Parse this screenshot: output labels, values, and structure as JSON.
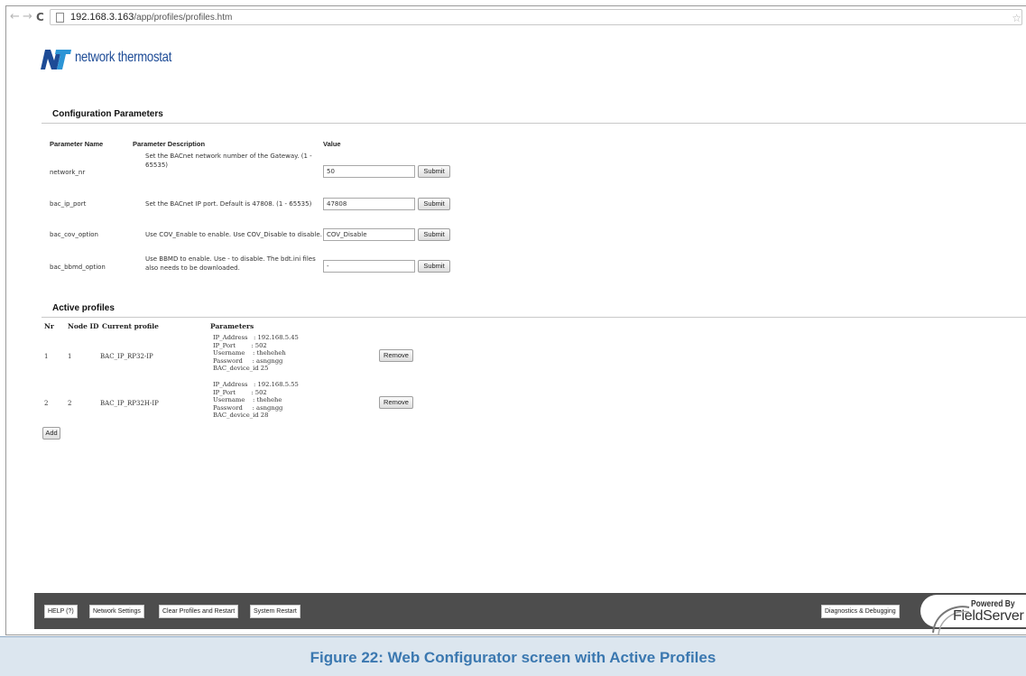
{
  "browser": {
    "url_host": "192.168.3.163",
    "url_path": "/app/profiles/profiles.htm"
  },
  "logo": {
    "text": "network thermostat"
  },
  "config": {
    "title": "Configuration Parameters",
    "headers": {
      "name": "Parameter Name",
      "description": "Parameter Description",
      "value": "Value"
    },
    "rows": [
      {
        "name": "network_nr",
        "description": "Set the BACnet network number of the Gateway. (1 - 65535)",
        "value": "50",
        "submit": "Submit"
      },
      {
        "name": "bac_ip_port",
        "description": "Set the BACnet IP port. Default is 47808. (1 - 65535)",
        "value": "47808",
        "submit": "Submit"
      },
      {
        "name": "bac_cov_option",
        "description": "Use COV_Enable to enable. Use COV_Disable to disable.",
        "value": "COV_Disable",
        "submit": "Submit"
      },
      {
        "name": "bac_bbmd_option",
        "description": "Use BBMD to enable. Use - to disable. The bdt.ini files also needs to be downloaded.",
        "value": "-",
        "submit": "Submit"
      }
    ]
  },
  "profiles": {
    "title": "Active profiles",
    "headers": {
      "nr": "Nr",
      "node_id": "Node ID",
      "current": "Current profile",
      "params": "Parameters"
    },
    "rows": [
      {
        "nr": "1",
        "node_id": "1",
        "profile": "BAC_IP_RP32-IP",
        "params": [
          "IP_Address   : 192.168.5.45",
          "IP_Port        : 502",
          "Username    : theheheh",
          "Password     : asngngg",
          "BAC_device_id 25"
        ],
        "remove": "Remove"
      },
      {
        "nr": "2",
        "node_id": "2",
        "profile": "BAC_IP_RP32H-IP",
        "params": [
          "IP_Address   : 192.168.5.55",
          "IP_Port        : 502",
          "Username    : thehehe",
          "Password     : asngngg",
          "BAC_device_id 28"
        ],
        "remove": "Remove"
      }
    ],
    "add": "Add"
  },
  "footer": {
    "help": "HELP (?)",
    "network": "Network Settings",
    "clear": "Clear Profiles and Restart",
    "restart": "System Restart",
    "diagnostics": "Diagnostics & Debugging",
    "powered": "Powered By",
    "brand": "FieldServer"
  },
  "caption": "Figure 22: Web Configurator screen with Active Profiles",
  "colors": {
    "logo_blue": "#1d4b96",
    "footer_bg": "#4d4d4d",
    "caption_text": "#3b78b0",
    "caption_bg": "#dce6ef"
  }
}
